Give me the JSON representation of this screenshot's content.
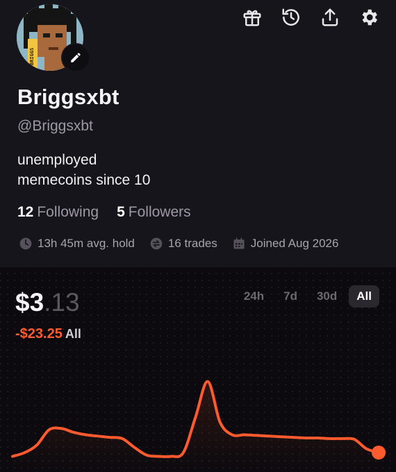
{
  "profile": {
    "display_name": "Briggsxbt",
    "handle": "@Briggsxbt",
    "bio_lines": [
      "unemployed",
      "memecoins since 10"
    ],
    "avatar_text": "BRIGGS",
    "following_count": "12",
    "following_label": "Following",
    "followers_count": "5",
    "followers_label": "Followers"
  },
  "top_icons": [
    "gift-icon",
    "history-icon",
    "share-icon",
    "settings-icon"
  ],
  "stats": {
    "hold": "13h 45m avg. hold",
    "trades": "16 trades",
    "joined": "Joined Aug 2026"
  },
  "portfolio": {
    "balance_main": "$3",
    "balance_cents": ".13",
    "change": "-$23.25",
    "change_period": "All",
    "ranges": [
      "24h",
      "7d",
      "30d",
      "All"
    ],
    "active_range": "All"
  },
  "colors": {
    "accent": "#ff5b2e",
    "background": "#17151c",
    "panel": "#0c0a0e"
  },
  "chart_data": {
    "type": "line",
    "x": [
      0,
      1,
      2,
      3,
      4,
      5,
      6,
      7,
      8,
      9,
      10,
      11,
      12,
      13,
      14,
      15,
      16,
      17,
      18,
      19,
      20,
      21,
      22,
      23,
      24,
      25,
      26,
      27,
      28,
      29,
      30
    ],
    "values": [
      3.0,
      6.0,
      12.0,
      24.0,
      25.0,
      22.0,
      20.0,
      19.0,
      18.0,
      17.0,
      10.0,
      4.0,
      3.0,
      3.0,
      6.0,
      34.0,
      62.0,
      30.0,
      20.0,
      20.0,
      19.5,
      19.0,
      18.5,
      18.0,
      17.5,
      17.5,
      17.0,
      17.0,
      16.5,
      9.0,
      6.0
    ],
    "ylim": [
      0,
      70
    ],
    "grid": "dotted",
    "end_marker": true
  }
}
